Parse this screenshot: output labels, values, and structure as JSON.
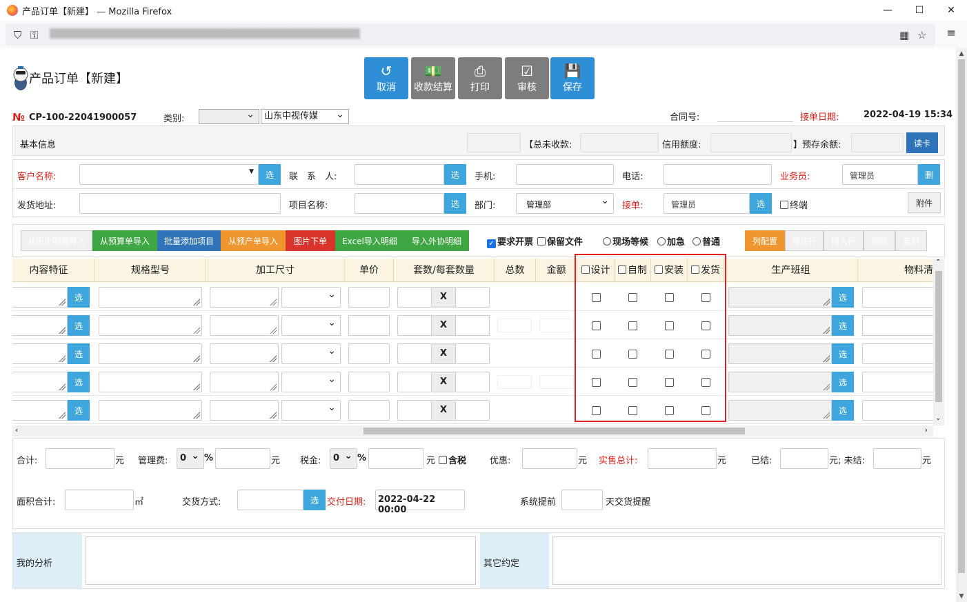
{
  "window": {
    "title": "产品订单【新建】 — Mozilla Firefox"
  },
  "page": {
    "title": "产品订单【新建】"
  },
  "toolbar": {
    "cancel": "取消",
    "receipt": "收款结算",
    "print": "打印",
    "audit": "审核",
    "save": "保存"
  },
  "order": {
    "no_prefix": "№",
    "no": "CP-100-22041900057",
    "category_label": "类别:",
    "category_value": "",
    "company_value": "山东中视传媒",
    "contract_label": "合同号:",
    "date_label": "接单日期:",
    "date_value": "2022-04-19 15:34"
  },
  "basic": {
    "title": "基本信息",
    "unpaid_label": "【总未收款:",
    "credit_label": "信用额度:",
    "prepaid_label": "】预存余额:",
    "readcard": "读卡"
  },
  "form": {
    "customer_label": "客户名称:",
    "contact_label": "联　系　人:",
    "mobile_label": "手机:",
    "phone_label": "电话:",
    "salesman_label": "业务员:",
    "salesman_value": "管理员",
    "del_btn": "删",
    "address_label": "发货地址:",
    "project_label": "项目名称:",
    "dept_label": "部门:",
    "dept_value": "管理部",
    "receiver_label": "接单:",
    "receiver_value": "管理员",
    "terminal_label": "终端",
    "attach_btn": "附件",
    "select_btn": "选"
  },
  "actions": {
    "history": "从历史明细导入",
    "budget": "从预算单导入",
    "batch": "批量添加项目",
    "pre": "从预产单导入",
    "image": "图片下单",
    "excel": "Excel导入明细",
    "outsource": "导入外协明细",
    "invoice": "要求开票",
    "keepfile": "保留文件",
    "wait": "现场等候",
    "urgent": "加急",
    "normal": "普通",
    "colcfg": "列配置",
    "addrow": "增加行",
    "insrow": "插入行",
    "delete": "删除",
    "copy": "复制"
  },
  "table": {
    "headers": [
      "内容特征",
      "规格型号",
      "加工尺寸",
      "单价",
      "套数/每套数量",
      "总数",
      "金额",
      "设计",
      "自制",
      "安装",
      "发货",
      "生产班组",
      "物料清"
    ],
    "times": "X",
    "rows": 5
  },
  "footer": {
    "total_label": "合计:",
    "yuan": "元",
    "mgmt_label": "管理费:",
    "mgmt_value": "0",
    "pct": "%",
    "tax_label": "税金:",
    "tax_value": "0",
    "tax_incl": "含税",
    "discount_label": "优惠:",
    "actual_label": "实售总计:",
    "settled_label": "已结:",
    "unsettled_label": "元; 未结:",
    "area_label": "面积合计:",
    "area_unit": "㎡",
    "delivery_mode_label": "交货方式:",
    "delivery_date_label": "交付日期:",
    "delivery_date_value": "2022-04-22 00:00",
    "remind_pre": "系统提前",
    "remind_post": "天交货提醒",
    "analysis_label": "我的分析",
    "other_label": "其它约定"
  }
}
